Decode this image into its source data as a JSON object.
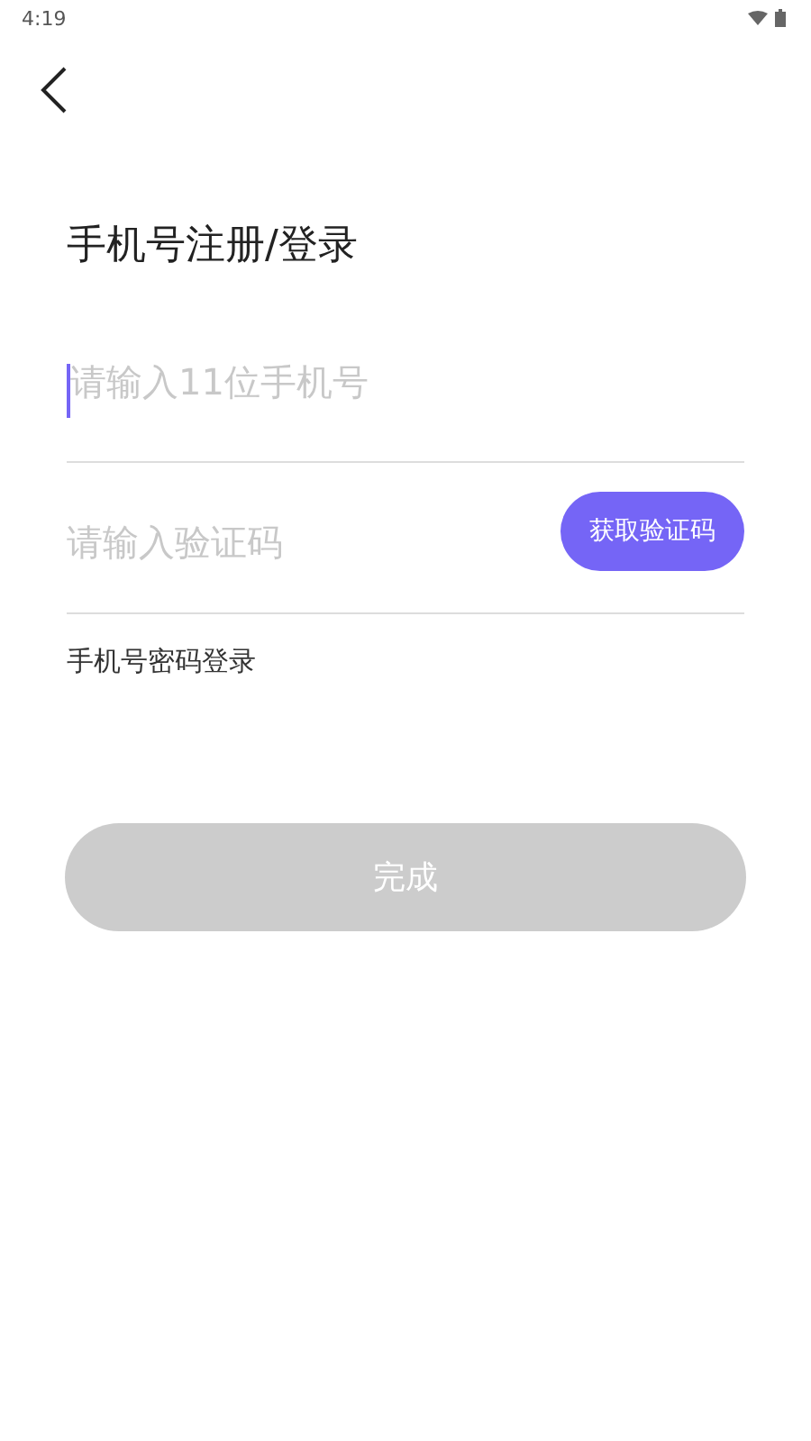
{
  "status_bar": {
    "time": "4:19"
  },
  "title": "手机号注册/登录",
  "phone_field": {
    "placeholder": "请输入11位手机号",
    "focused": true
  },
  "code_field": {
    "placeholder": "请输入验证码"
  },
  "get_code_button": {
    "label": "获取验证码"
  },
  "password_login_link": "手机号密码登录",
  "submit_button": {
    "label": "完成",
    "disabled": true
  }
}
